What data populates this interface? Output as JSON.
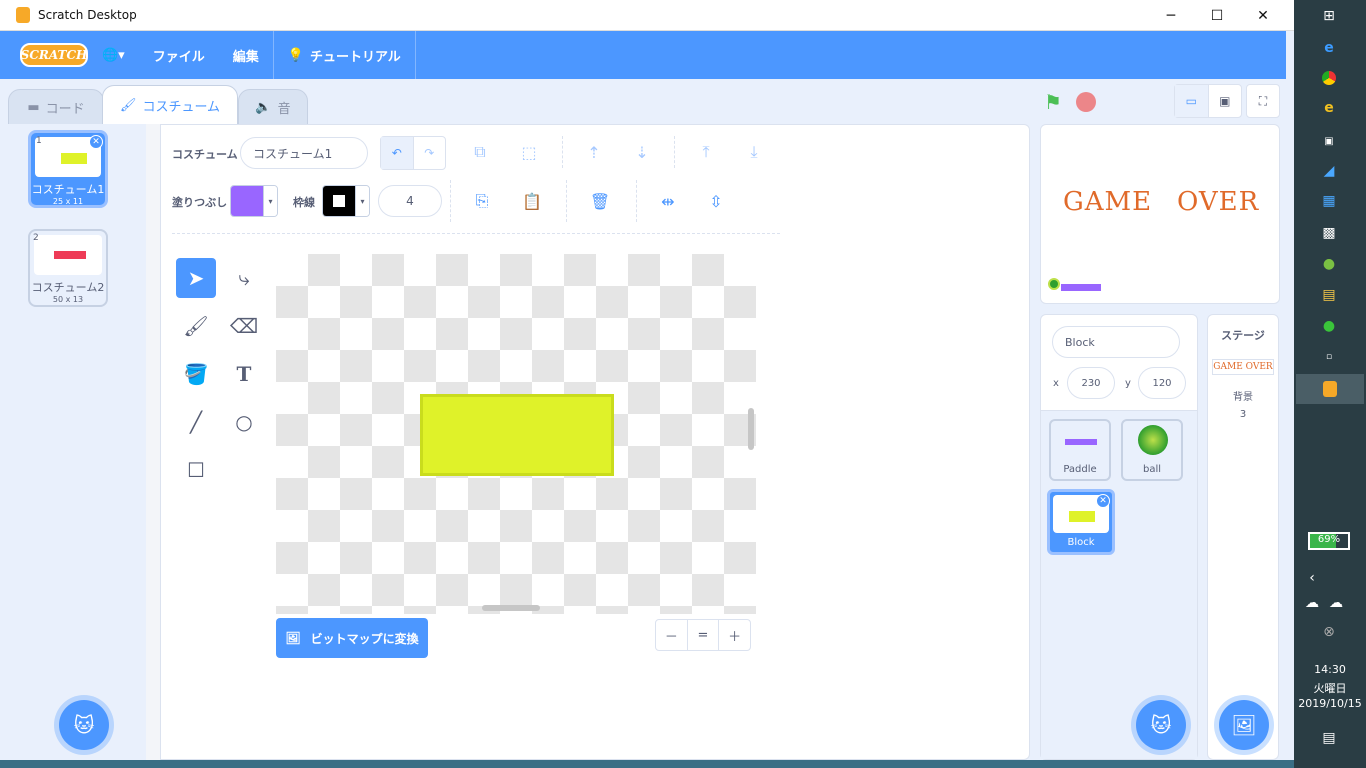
{
  "window": {
    "title": "Scratch Desktop",
    "minimize": "─",
    "maximize": "☐",
    "close": "✕"
  },
  "menubar": {
    "logo": "SCRATCH",
    "lang_icon": "🌐▾",
    "file": "ファイル",
    "edit": "編集",
    "tutorial": "チュートリアル"
  },
  "tabs": {
    "code": "コード",
    "costume": "コスチューム",
    "sound": "音"
  },
  "costumes": [
    {
      "num": "1",
      "name": "コスチューム1",
      "size": "25 x 11",
      "selected": true,
      "color": "#dff229"
    },
    {
      "num": "2",
      "name": "コスチューム2",
      "size": "50 x 13",
      "selected": false,
      "color": "#ee3b57"
    }
  ],
  "editor": {
    "costume_label": "コスチューム",
    "costume_name": "コスチューム1",
    "fill_label": "塗りつぶし",
    "fill_color": "#9966ff",
    "outline_label": "枠線",
    "outline_color": "#000000",
    "outline_width": "4",
    "convert_button": "ビットマップに変換",
    "zoom_out": "－",
    "zoom_reset": "=",
    "zoom_in": "＋"
  },
  "stage": {
    "text1": "GAME",
    "text2": "OVER"
  },
  "sprite_info": {
    "name": "Block",
    "x_label": "x",
    "x": "230",
    "y_label": "y",
    "y": "120"
  },
  "sprites": [
    {
      "name": "Paddle",
      "selected": false
    },
    {
      "name": "ball",
      "selected": false
    },
    {
      "name": "Block",
      "selected": true
    }
  ],
  "stage_pane": {
    "title": "ステージ",
    "thumb_text": "GAME OVER",
    "backdrops_label": "背景",
    "backdrops_count": "3"
  },
  "taskbar": {
    "battery": "69%",
    "time": "14:30",
    "weekday": "火曜日",
    "date": "2019/10/15"
  }
}
